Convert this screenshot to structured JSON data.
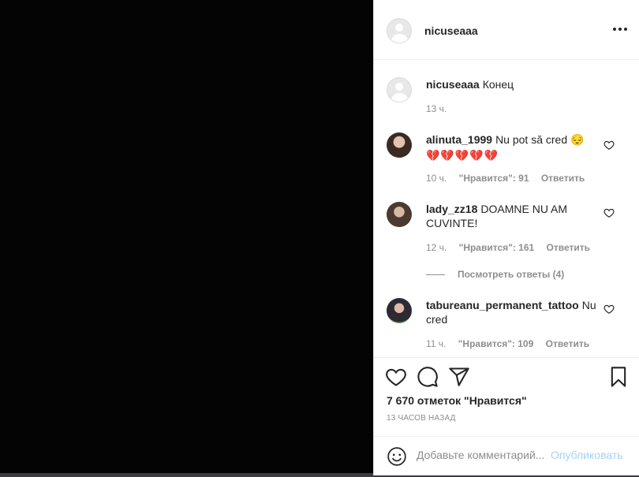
{
  "post": {
    "author": "nicuseaaa",
    "more_icon": "more-horizontal-icon"
  },
  "caption": {
    "username": "nicuseaaa",
    "text": "Конец",
    "time": "13 ч."
  },
  "comments": [
    {
      "username": "alinuta_1999",
      "text": "Nu pot să cred 😔",
      "extra": "💔💔💔💔💔",
      "time": "10 ч.",
      "likes": "\"Нравится\": 91",
      "reply": "Ответить"
    },
    {
      "username": "lady_zz18",
      "text": "DOAMNE NU AM CUVINTE!",
      "time": "12 ч.",
      "likes": "\"Нравится\": 161",
      "reply": "Ответить",
      "view_replies": "Посмотреть ответы (4)"
    },
    {
      "username": "tabureanu_permanent_tattoo",
      "text": "Nu cred",
      "time": "11 ч.",
      "likes": "\"Нравится\": 109",
      "reply": "Ответить"
    }
  ],
  "actions": {
    "icons": [
      "heart-icon",
      "comment-icon",
      "share-icon",
      "bookmark-icon"
    ],
    "likes_count": "7 670 отметок \"Нравится\"",
    "time_ago": "13 ЧАСОВ НАЗАД"
  },
  "add_comment": {
    "placeholder": "Добавьте комментарий...",
    "post_label": "Опубликовать"
  },
  "colors": {
    "link_disabled": "#a7d1f5",
    "secondary_text": "#8e8e8e",
    "primary_text": "#262626"
  }
}
